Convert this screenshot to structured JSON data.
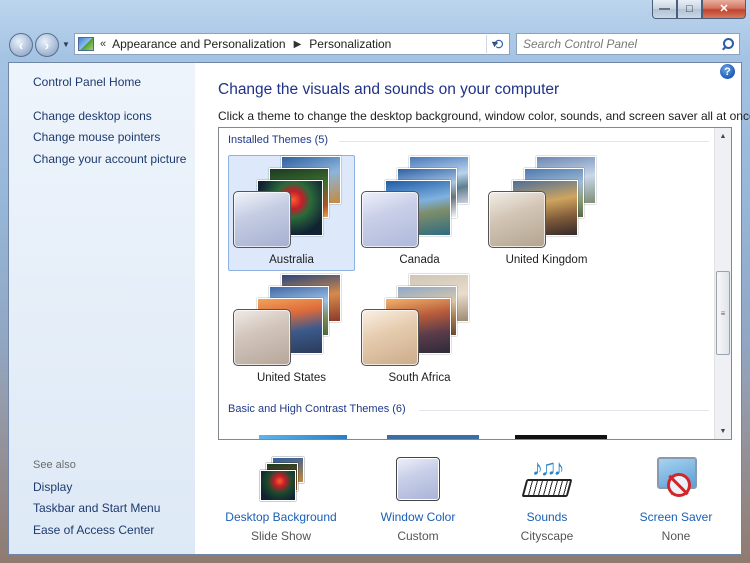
{
  "window": {
    "controls": [
      "—",
      "□",
      "✕"
    ]
  },
  "address": {
    "chevron": "«",
    "crumbs": [
      "Appearance and Personalization",
      "Personalization"
    ],
    "search_placeholder": "Search Control Panel"
  },
  "sidebar": {
    "home": "Control Panel Home",
    "links": [
      "Change desktop icons",
      "Change mouse pointers",
      "Change your account picture"
    ],
    "see_also_label": "See also",
    "see_also": [
      "Display",
      "Taskbar and Start Menu",
      "Ease of Access Center"
    ]
  },
  "main": {
    "title": "Change the visuals and sounds on your computer",
    "description": "Click a theme to change the desktop background, window color, sounds, and screen saver all at once.",
    "installed_header": "Installed Themes (5)",
    "basic_header": "Basic and High Contrast Themes (6)",
    "themes": [
      {
        "name": "Australia",
        "selected": true
      },
      {
        "name": "Canada",
        "selected": false
      },
      {
        "name": "United Kingdom",
        "selected": false
      },
      {
        "name": "United States",
        "selected": false
      },
      {
        "name": "South Africa",
        "selected": false
      }
    ]
  },
  "bottom": [
    {
      "link": "Desktop Background",
      "sub": "Slide Show",
      "icon": "desktop-background-icon"
    },
    {
      "link": "Window Color",
      "sub": "Custom",
      "icon": "window-color-icon"
    },
    {
      "link": "Sounds",
      "sub": "Cityscape",
      "icon": "sounds-icon"
    },
    {
      "link": "Screen Saver",
      "sub": "None",
      "icon": "screen-saver-icon"
    }
  ],
  "colors": {
    "link": "#1a5fb4",
    "title": "#1e3287",
    "sidebar_link": "#1e3a6e",
    "selection": "#dde9fb"
  }
}
